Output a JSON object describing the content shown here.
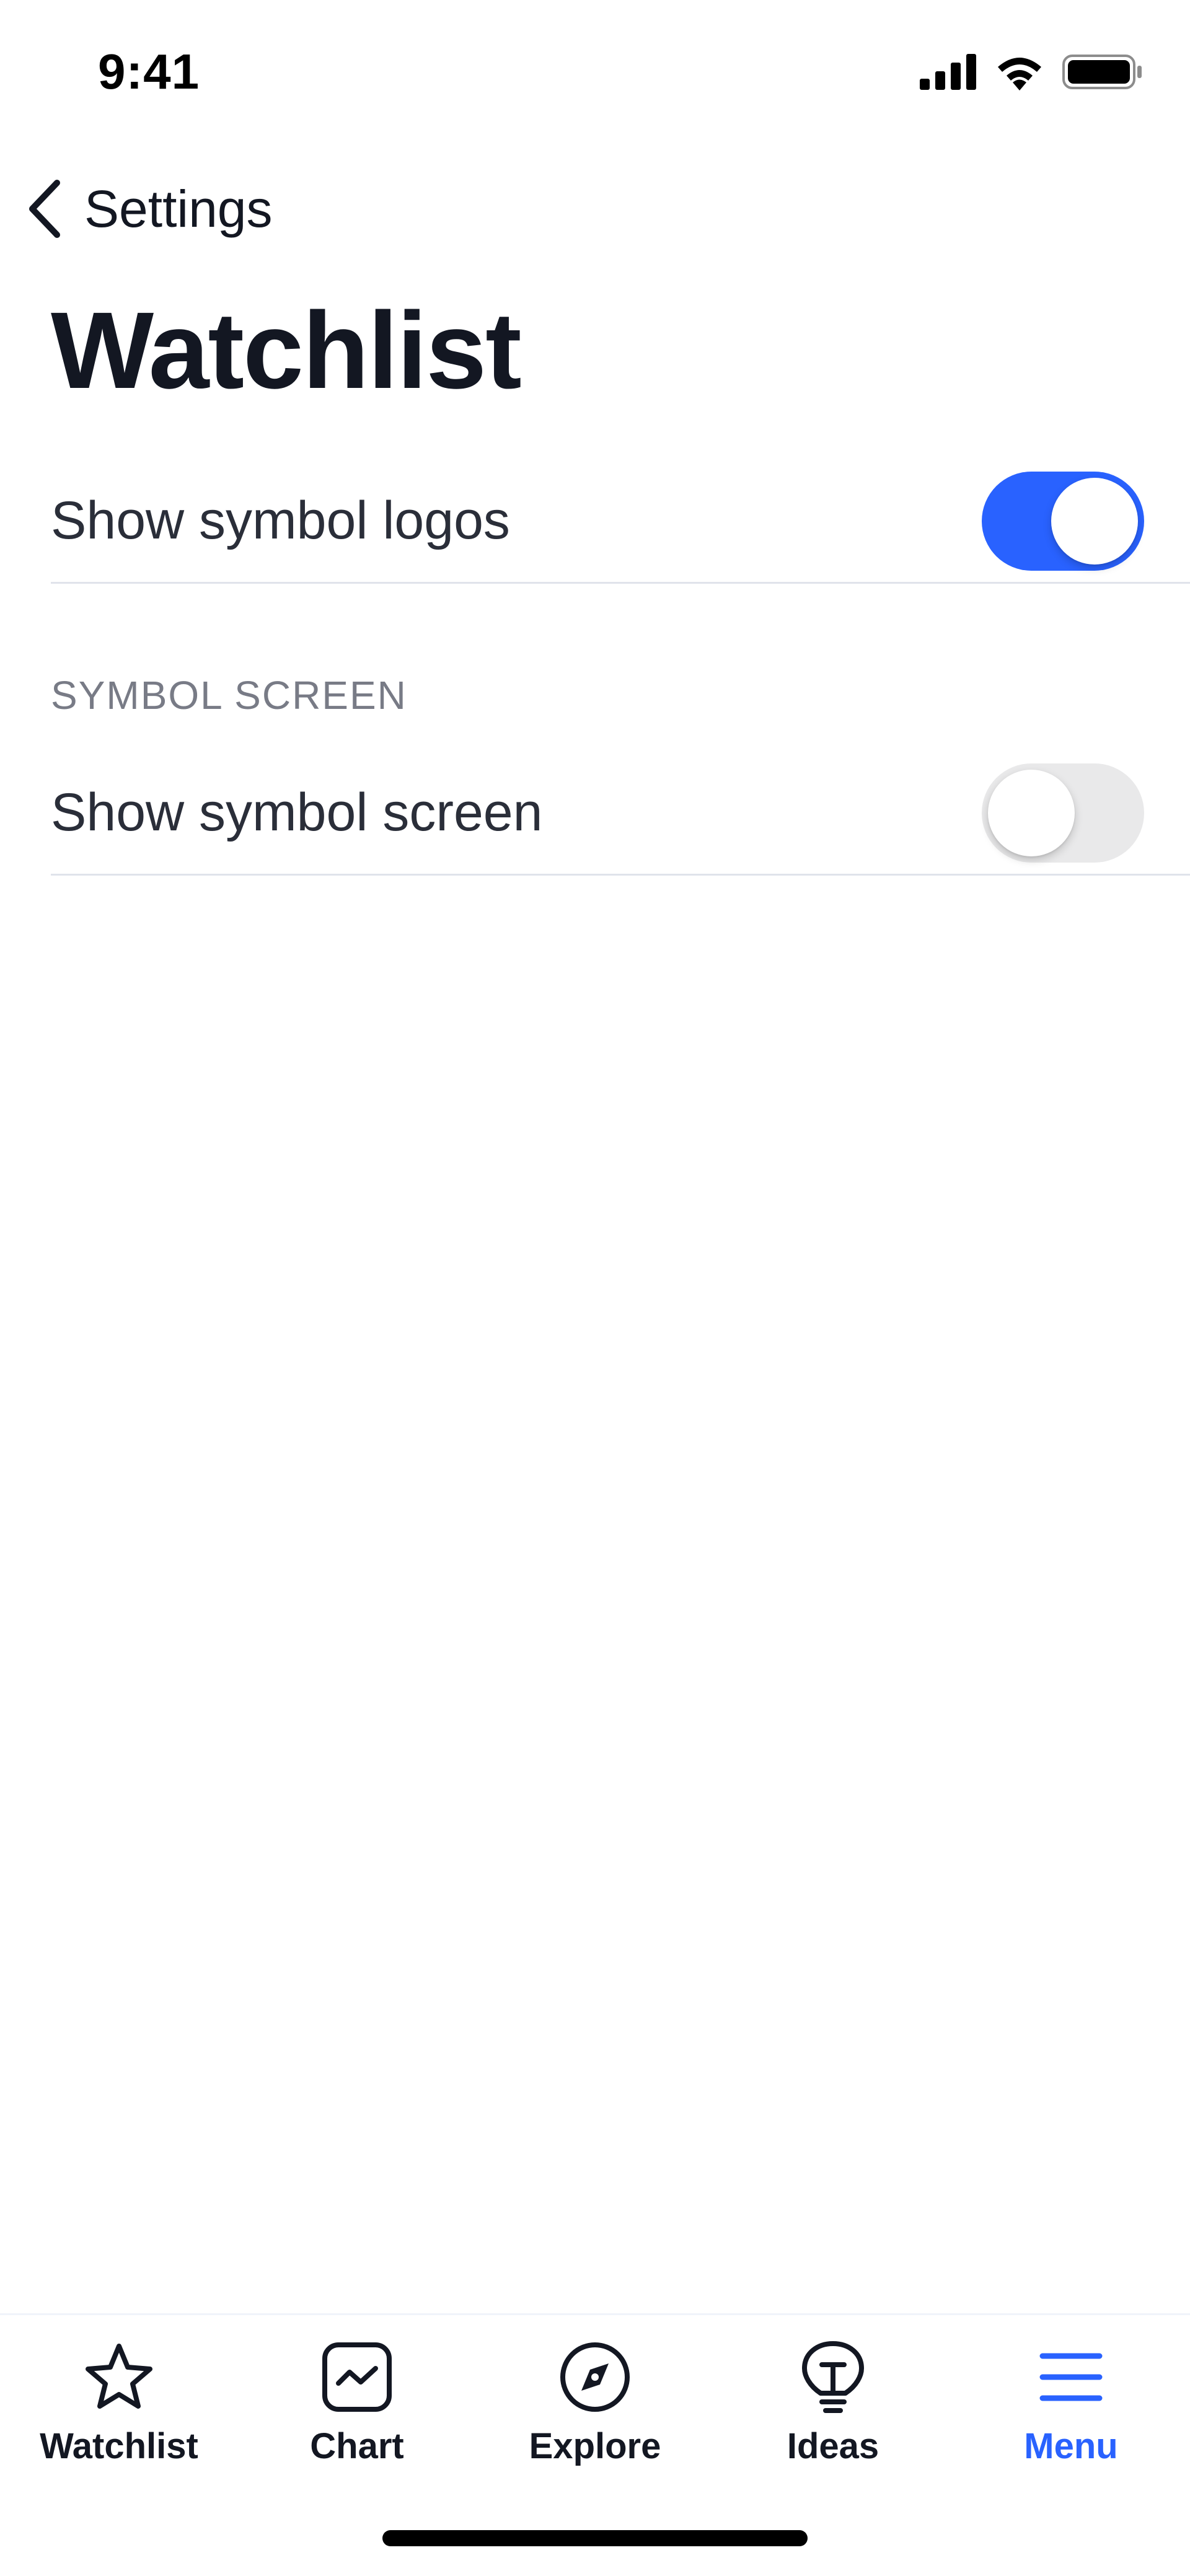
{
  "status_bar": {
    "time": "9:41",
    "icons": [
      "cellular-signal-icon",
      "wifi-icon",
      "battery-icon"
    ]
  },
  "nav": {
    "back_label": "Settings",
    "back_icon": "chevron-left-icon"
  },
  "page": {
    "title": "Watchlist"
  },
  "settings": {
    "show_symbol_logos": {
      "label": "Show symbol logos",
      "enabled": true
    },
    "symbol_screen_section": {
      "header": "SYMBOL SCREEN"
    },
    "show_symbol_screen": {
      "label": "Show symbol screen",
      "enabled": false
    }
  },
  "tab_bar": {
    "tabs": [
      {
        "label": "Watchlist",
        "icon": "star-icon",
        "active": false
      },
      {
        "label": "Chart",
        "icon": "chart-icon",
        "active": false
      },
      {
        "label": "Explore",
        "icon": "compass-icon",
        "active": false
      },
      {
        "label": "Ideas",
        "icon": "lightbulb-icon",
        "active": false
      },
      {
        "label": "Menu",
        "icon": "hamburger-menu-icon",
        "active": true
      }
    ]
  },
  "colors": {
    "accent": "#2962ff",
    "text_primary": "#131722",
    "text_secondary": "#787b86",
    "toggle_off": "#e9e9ea",
    "divider": "#e0e3eb"
  }
}
